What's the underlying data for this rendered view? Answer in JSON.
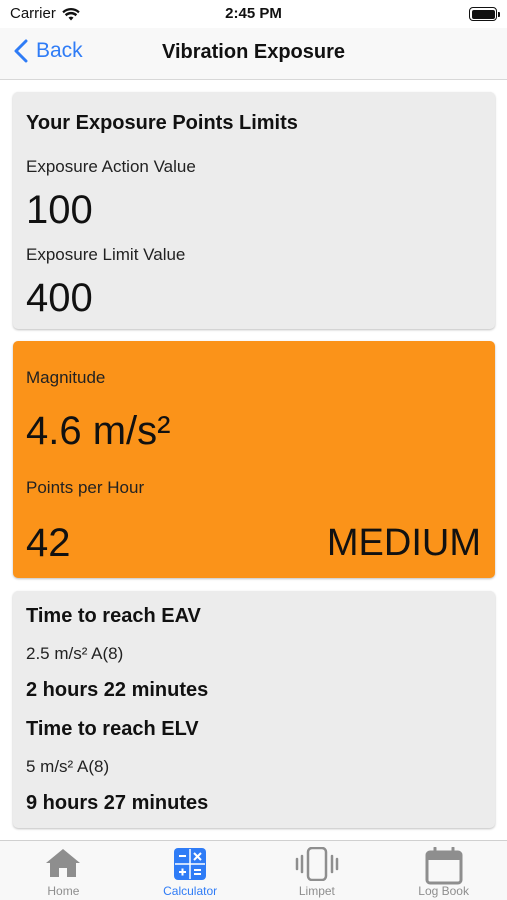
{
  "status_bar": {
    "carrier": "Carrier",
    "time": "2:45 PM"
  },
  "nav": {
    "back_label": "Back",
    "title": "Vibration Exposure"
  },
  "limits_card": {
    "heading": "Your Exposure Points Limits",
    "eav_label": "Exposure Action Value",
    "eav_value": "100",
    "elv_label": "Exposure Limit Value",
    "elv_value": "400"
  },
  "magnitude_card": {
    "magnitude_label": "Magnitude",
    "magnitude_value": "4.6 m/s²",
    "points_label": "Points per Hour",
    "points_value": "42",
    "level": "MEDIUM",
    "color": "#fb9319"
  },
  "time_card": {
    "eav_heading": "Time to reach EAV",
    "eav_threshold": "2.5 m/s² A(8)",
    "eav_time": "2 hours 22 minutes",
    "elv_heading": "Time to reach ELV",
    "elv_threshold": "5 m/s² A(8)",
    "elv_time": "9 hours 27 minutes"
  },
  "tabs": [
    {
      "label": "Home",
      "icon": "home-icon",
      "active": false
    },
    {
      "label": "Calculator",
      "icon": "calculator-icon",
      "active": true
    },
    {
      "label": "Limpet",
      "icon": "vibrating-phone-icon",
      "active": false
    },
    {
      "label": "Log Book",
      "icon": "calendar-icon",
      "active": false
    }
  ],
  "colors": {
    "accent": "#2f7cf6",
    "card_bg": "#ececec",
    "medium": "#fb9319"
  }
}
